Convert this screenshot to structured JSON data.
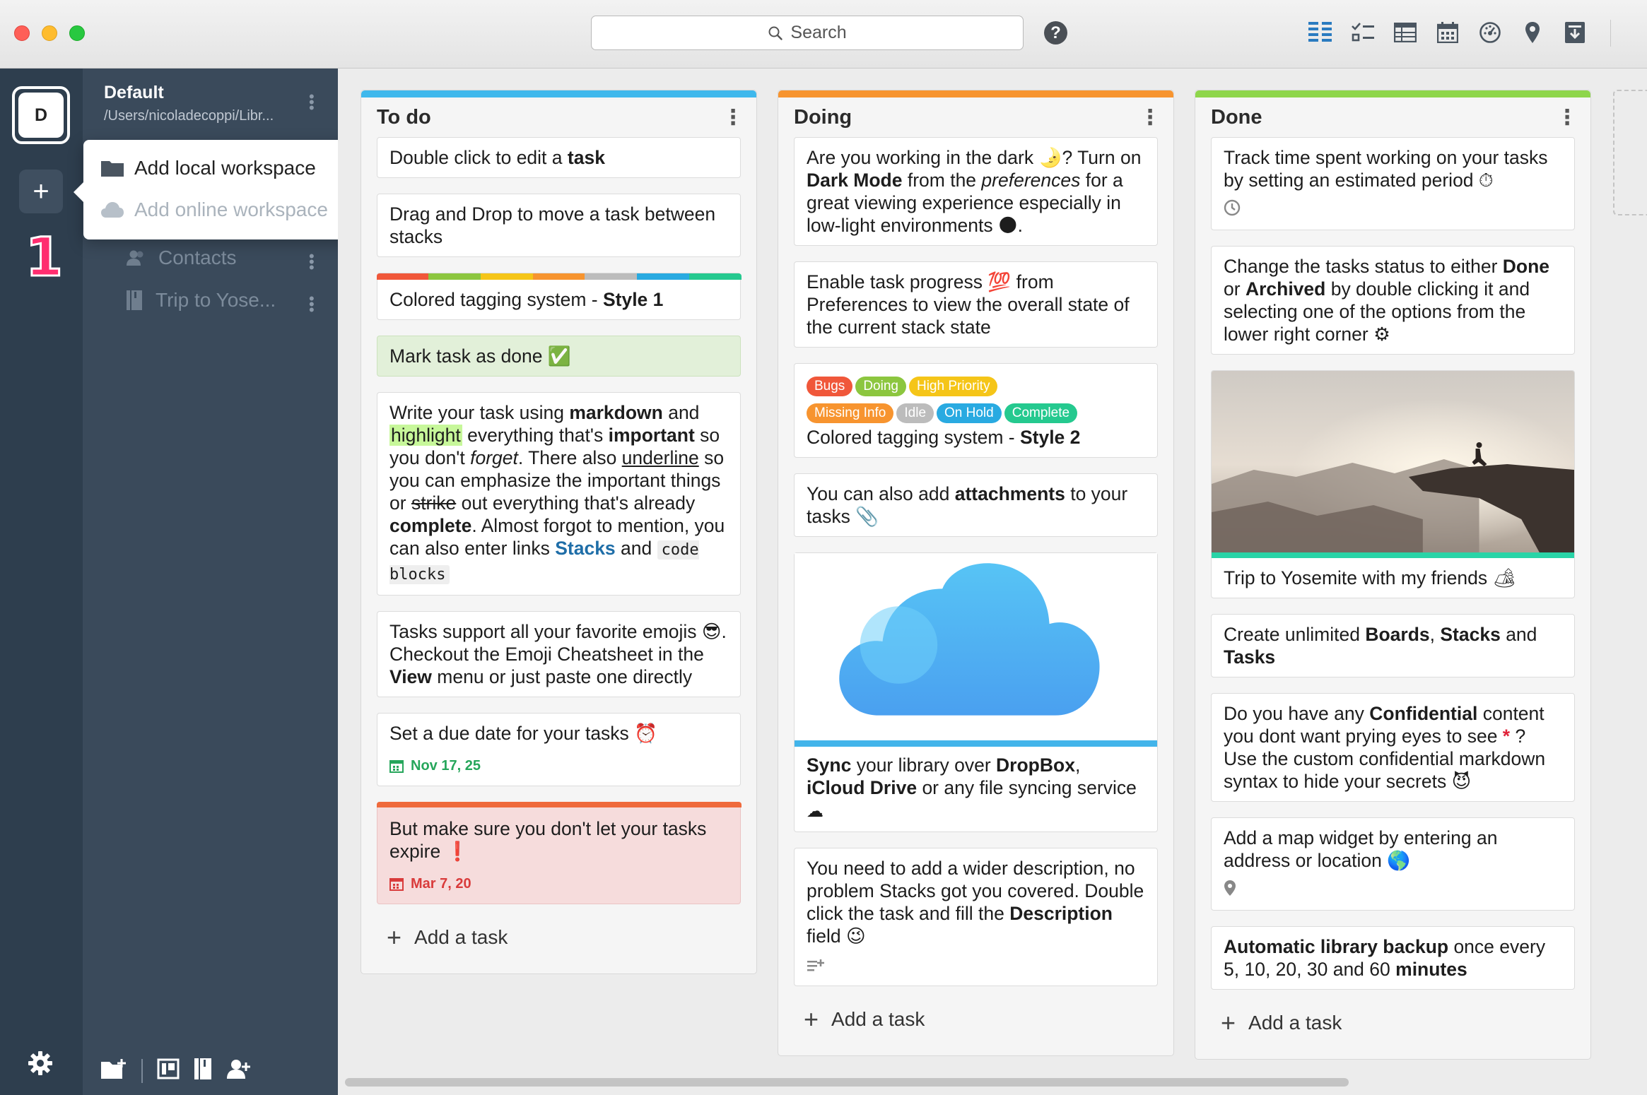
{
  "toolbar": {
    "search_placeholder": "Search",
    "icons": [
      "kanban-icon",
      "checklist-icon",
      "table-icon",
      "calendar-icon",
      "dashboard-icon",
      "map-pin-icon",
      "archive-icon"
    ]
  },
  "rail": {
    "workspace_initial": "D",
    "add_label": "+",
    "step_badge": "1"
  },
  "sidebar": {
    "workspace_title": "Default",
    "workspace_path": "/Users/nicoladecoppi/Libr...",
    "items": [
      {
        "label": "Contacts",
        "icon": "contacts-icon"
      },
      {
        "label": "Trip to Yose...",
        "icon": "book-icon"
      }
    ]
  },
  "dropdown": {
    "add_local": "Add local workspace",
    "add_online": "Add online workspace"
  },
  "colors": {
    "todo": "#3fb8ec",
    "doing": "#f7942f",
    "done": "#8ed64b",
    "tag_bugs": "#f0573a",
    "tag_doing": "#8cc63f",
    "tag_high": "#f5c518",
    "tag_missing": "#f7942f",
    "tag_idle": "#bcbcbc",
    "tag_onhold": "#29aae1",
    "tag_complete": "#25c98f"
  },
  "stacks": {
    "todo": {
      "title": "To do",
      "add_task": "Add a task",
      "cards": {
        "c1": {
          "pre": "Double click to edit a ",
          "bold": "task"
        },
        "c2": "Drag and Drop to move a task between stacks",
        "c3": {
          "pre": "Colored tagging system - ",
          "bold": "Style 1"
        },
        "c4": {
          "text": "Mark task as done",
          "emoji": "✅"
        },
        "c5": {
          "a": "Write your task using ",
          "b": "markdown",
          "c": " and ",
          "d": "highlight",
          "e": " everything that's ",
          "f": "important",
          "g": " so you don't ",
          "h": "forget",
          "i": ". There also ",
          "j": "underline",
          "k": " so you can emphasize the important things or ",
          "l": "strike",
          "m": " out everything that's already ",
          "n": "complete",
          "o": ". Almost forgot to mention, you can also enter links ",
          "p": "Stacks",
          "q": " and ",
          "r": "code blocks"
        },
        "c6": {
          "a": "Tasks support all your favorite emojis ",
          "emoji": "😎",
          "b": ". Checkout the Emoji Cheatsheet in the ",
          "bold": "View",
          "c": " menu or just paste one directly"
        },
        "c7": {
          "text": "Set a due date for your tasks ",
          "emoji": "⏰",
          "due": "Nov 17, 25"
        },
        "c8": {
          "text": "But make sure you don't let your tasks expire ",
          "emoji": "❗",
          "due": "Mar 7, 20"
        }
      }
    },
    "doing": {
      "title": "Doing",
      "add_task": "Add a task",
      "cards": {
        "c1": {
          "a": "Are you working in the dark ",
          "e1": "🌛",
          "b": "? Turn on ",
          "bold": "Dark Mode",
          "c": " from the ",
          "ital": "preferences",
          "d": " for a great viewing experience especially in low-light environments ",
          "e2": "🌑",
          "f": "."
        },
        "c2": {
          "a": "Enable task progress ",
          "emoji": "💯",
          "b": " from Preferences to view the overall state of the current stack state"
        },
        "c3": {
          "tags": [
            "Bugs",
            "Doing",
            "High Priority",
            "Missing Info",
            "Idle",
            "On Hold",
            "Complete"
          ],
          "pre": "Colored tagging system - ",
          "bold": "Style 2"
        },
        "c4": {
          "a": "You can also add ",
          "bold": "attachments",
          "b": " to your tasks ",
          "emoji": "📎"
        },
        "c5": {
          "b1": "Sync",
          "a": " your library over ",
          "b2": "DropBox",
          "c": ",",
          "b3": "iCloud Drive",
          "d": " or any file syncing service",
          "emoji": "☁"
        },
        "c6": {
          "a": "You need to add a wider description, no problem Stacks got you covered. Double click the task and fill the ",
          "bold": "Description",
          "b": " field ",
          "emoji": "😉"
        }
      }
    },
    "done": {
      "title": "Done",
      "add_task": "Add a task",
      "cards": {
        "c1": {
          "a": "Track time spent working on your tasks by setting an estimated period ",
          "emoji": "⏱"
        },
        "c2": {
          "a": "Change the tasks status to either ",
          "b1": "Done",
          "b": " or ",
          "b2": "Archived",
          "c": " by double clicking it and selecting one of the options from the lower right corner ",
          "emoji": "⚙"
        },
        "c3": {
          "a": "Trip to Yosemite with my friends ",
          "emoji": "🏕"
        },
        "c4": {
          "a": "Create unlimited ",
          "b1": "Boards",
          "b": ", ",
          "b2": "Stacks",
          "c": " and ",
          "b3": "Tasks"
        },
        "c5": {
          "a": "Do you have any ",
          "bold": "Confidential",
          "b": " content you dont want prying eyes to see ",
          "e1": "*",
          "c": " ? Use the custom confidential markdown syntax to hide your secrets ",
          "e2": "😈"
        },
        "c6": {
          "a": "Add a map widget by entering an address or location ",
          "emoji": "🌎"
        },
        "c7": {
          "bold": "Automatic library backup",
          "a": " once every 5, 10, 20, 30 and 60 ",
          "b": "minutes"
        }
      }
    }
  }
}
